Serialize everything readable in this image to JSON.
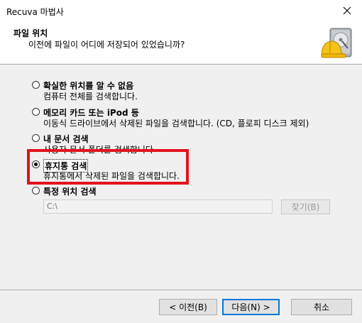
{
  "window": {
    "title": "Recuva 마법사"
  },
  "header": {
    "title": "파일 위치",
    "subtitle": "이전에 파일이 어디에 저장되어 있었습니까?"
  },
  "options": [
    {
      "label": "확실한 위치를 알 수 없음",
      "desc": "컴퓨터 전체를 검색합니다.",
      "selected": false
    },
    {
      "label": "메모리 카드 또는 iPod 등",
      "desc": "이동식 드라이브에서 삭제된 파일을 검색합니다. (CD, 플로피 디스크 제외)",
      "selected": false
    },
    {
      "label": "내 문서 검색",
      "desc": "사용자 문서 폴더를 검색합니다",
      "selected": false
    },
    {
      "label": "휴지통 검색",
      "desc": "휴지통에서 삭제된 파일을 검색합니다.",
      "selected": true
    },
    {
      "label": "특정 위치 검색",
      "desc": "",
      "selected": false
    }
  ],
  "path": {
    "value": "C:\\"
  },
  "browse": {
    "label": "찾기(B)"
  },
  "footer": {
    "back_label": "< 이전(B)",
    "next_label": "다음(N) >",
    "cancel_label": "취소"
  },
  "colors": {
    "highlight": "#e2131b",
    "accent": "#0078d7"
  }
}
